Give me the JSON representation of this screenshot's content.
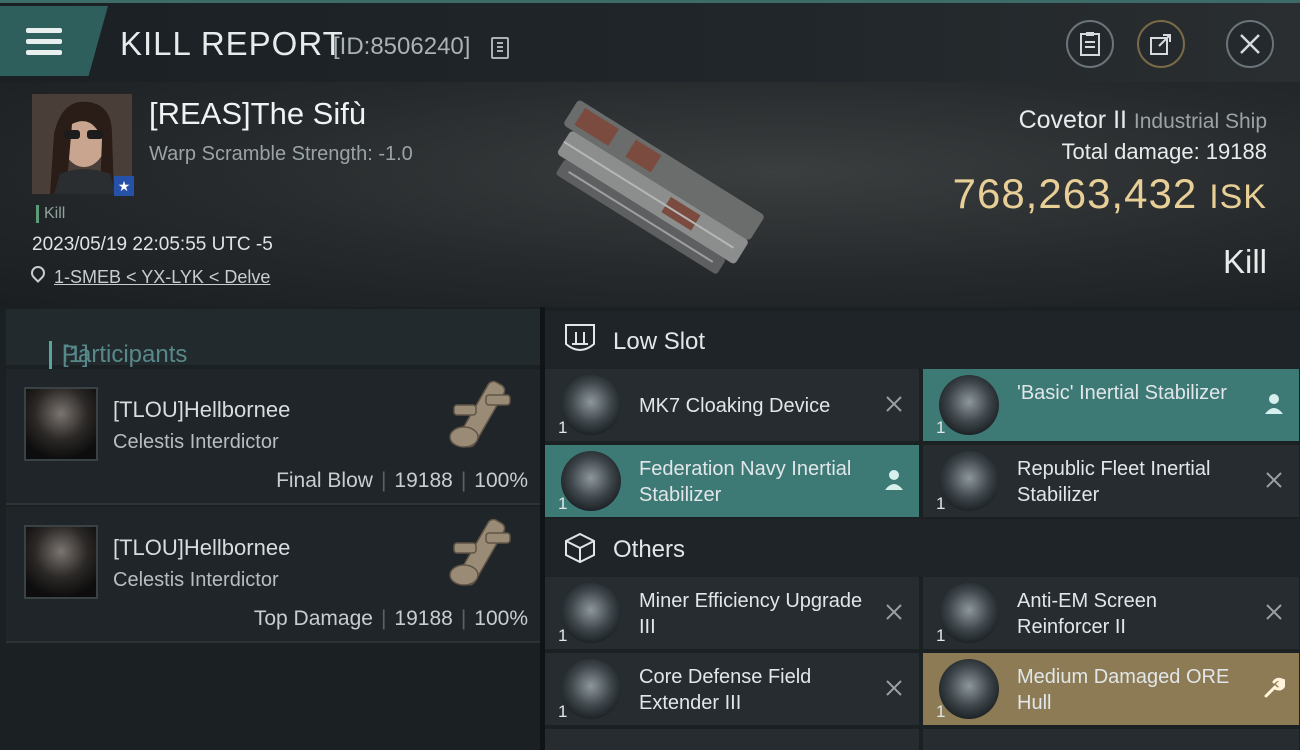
{
  "header": {
    "title": "KILL REPORT",
    "report_id": "[ID:8506240]"
  },
  "victim": {
    "name": "[REAS]The Sifù",
    "warp_scramble": "Warp Scramble Strength: -1.0",
    "tag": "Kill",
    "datetime": "2023/05/19 22:05:55 UTC -5",
    "location": "1-SMEB < YX-LYK < Delve",
    "ship": "Covetor II",
    "ship_class": "Industrial Ship",
    "total_damage": "Total damage:  19188",
    "isk_value": "768,263,432",
    "isk_unit": "ISK",
    "result": "Kill"
  },
  "participants": {
    "label": "Participants",
    "count": "[1]",
    "items": [
      {
        "name": "[TLOU]Hellbornee",
        "ship": "Celestis Interdictor",
        "role": "Final Blow",
        "damage": "19188",
        "percent": "100%"
      },
      {
        "name": "[TLOU]Hellbornee",
        "ship": "Celestis Interdictor",
        "role": "Top Damage",
        "damage": "19188",
        "percent": "100%"
      }
    ]
  },
  "sections": {
    "low_slot": "Low Slot",
    "others": "Others"
  },
  "low_slot_items": [
    {
      "name": "MK7 Cloaking Device",
      "qty": "1",
      "status": "destroyed"
    },
    {
      "name": "'Basic' Inertial Stabilizer",
      "qty": "1",
      "status": "dropped"
    },
    {
      "name": "Federation Navy Inertial Stabilizer",
      "qty": "1",
      "status": "dropped"
    },
    {
      "name": "Republic Fleet Inertial Stabilizer",
      "qty": "1",
      "status": "destroyed"
    }
  ],
  "other_items": [
    {
      "name": "Miner Efficiency Upgrade III",
      "qty": "1",
      "status": "destroyed"
    },
    {
      "name": "Anti-EM Screen Reinforcer II",
      "qty": "1",
      "status": "destroyed"
    },
    {
      "name": "Core Defense Field Extender III",
      "qty": "1",
      "status": "destroyed"
    },
    {
      "name": "Medium Damaged ORE Hull",
      "qty": "1",
      "status": "salvage"
    }
  ],
  "colors": {
    "accent_teal": "#3d7a76",
    "isk_gold": "#e8cf97",
    "salvage_gold": "#8c7b55"
  },
  "icons": [
    "menu-icon",
    "copy-icon",
    "clipboard-icon",
    "share-icon",
    "close-icon",
    "location-pin-icon",
    "shield-icon",
    "box-icon",
    "pilot-icon",
    "wrench-icon",
    "x-icon"
  ]
}
